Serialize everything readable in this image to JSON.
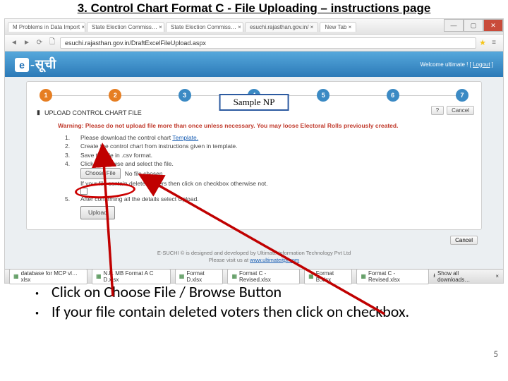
{
  "slide": {
    "title": "3. Control Chart Format C - File Uploading – instructions page",
    "page_number": "5"
  },
  "browser": {
    "tabs": [
      "M Problems in Data Import   ×",
      "State Election Commiss…  ×",
      "State Election Commiss…  ×",
      "esuchi.rajasthan.gov.in/  ×",
      "New Tab   ×"
    ],
    "url": "esuchi.rajasthan.gov.in/DraftExcelFileUpload.aspx",
    "window_controls": {
      "min": "—",
      "max": "▢",
      "close": "✕"
    }
  },
  "header": {
    "logo_e": "e",
    "logo_text": "-सूची",
    "welcome_prefix": "Welcome ultimate ! [ ",
    "logout": "Logout",
    "welcome_suffix": " ]"
  },
  "sample_np": "Sample NP",
  "steps": {
    "items": [
      "1",
      "2",
      "3",
      "4",
      "5",
      "6",
      "7"
    ],
    "colors": [
      "#e67e22",
      "#e67e22",
      "#3b8ac4",
      "#3b8ac4",
      "#3b8ac4",
      "#3b8ac4",
      "#3b8ac4"
    ]
  },
  "section_label": "UPLOAD CONTROL CHART FILE",
  "top_buttons": {
    "help": "?",
    "cancel": "Cancel"
  },
  "warning": "Warning: Please do not upload file more than once unless necessary. You may loose Electoral Rolls previously created.",
  "instructions": {
    "n1": "1.",
    "t1a": "Please download the control chart ",
    "t1_link": "Template.",
    "n2": "2.",
    "t2": "Create the control chart from instructions given in template.",
    "n3": "3.",
    "t3": "Save the file in .csv format.",
    "n4": "4.",
    "t4_prefix": "Click on Browse and select the file.",
    "choose_file_label": "Choose File",
    "no_file": "No file chosen.",
    "t4_check": "If your file contain deleted voters then click on checkbox otherwise not.",
    "n5": "5.",
    "t5": "After confirming all the details select Upload.",
    "upload_label": "Upload"
  },
  "lower_cancel": "Cancel",
  "footer": {
    "line1": "E-SUCHI © is designed and developed by Ultimate Information Technology Pvt Ltd",
    "line2_prefix": "Please visit us at ",
    "line2_link": "www.ultimateitpl.com"
  },
  "downloads": {
    "items": [
      "database for MCP vl…xlsx",
      "N.P. MB Format A C D.xlsx",
      "Format D.xlsx",
      "Format C - Revised.xlsx",
      "Format B.xlsx",
      "Format C - Revised.xlsx"
    ],
    "show_all": "Show all downloads…",
    "close": "×"
  },
  "bullets": {
    "b1": "Click on Choose File / Browse Button",
    "b2": "If your file contain deleted voters then click on checkbox."
  }
}
